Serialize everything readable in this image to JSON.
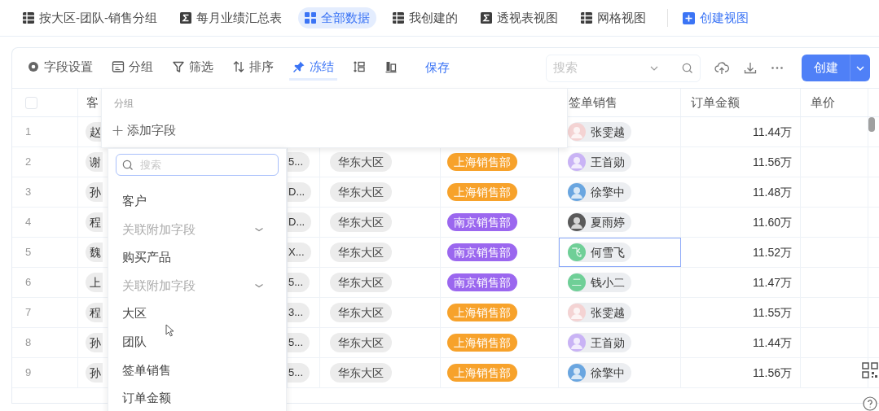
{
  "tabs": [
    {
      "label": "按大区-团队-销售分组",
      "kind": "grid",
      "selected": false
    },
    {
      "label": "每月业绩汇总表",
      "kind": "sigma",
      "selected": false
    },
    {
      "label": "全部数据",
      "kind": "tiles",
      "selected": true
    },
    {
      "label": "我创建的",
      "kind": "grid",
      "selected": false
    },
    {
      "label": "透视表视图",
      "kind": "sigma",
      "selected": false
    },
    {
      "label": "网格视图",
      "kind": "grid",
      "selected": false
    }
  ],
  "create_view": "创建视图",
  "toolbar": [
    {
      "kind": "gear",
      "label": "字段设置",
      "selected": false
    },
    {
      "kind": "group",
      "label": "分组",
      "selected": false
    },
    {
      "kind": "filter",
      "label": "筛选",
      "selected": false
    },
    {
      "kind": "sort",
      "label": "排序",
      "selected": false
    },
    {
      "kind": "pin",
      "label": "冻结",
      "selected": true
    },
    {
      "kind": "row-height",
      "selected": false
    },
    {
      "kind": "columns",
      "selected": false
    }
  ],
  "save": "保存",
  "search": {
    "placeholder": "搜索"
  },
  "create_button": "创建",
  "table": {
    "select_all": {
      "checked": false
    },
    "header": {
      "customer": "客",
      "seller": "签单销售",
      "amount": "订单金额",
      "price": "单价"
    },
    "rows": [
      {
        "number": "1",
        "customer": "赵",
        "seller": {
          "name": "张雯越",
          "color": "#f4d3d3",
          "selected": false
        },
        "amount": "11.44万"
      },
      {
        "number": "2",
        "customer": "谢",
        "code": "5...",
        "region": "华东大区",
        "team": {
          "label": "上海销售部",
          "color": "#f7a22b"
        },
        "seller": {
          "name": "王首勋",
          "color": "#c9b3f5",
          "selected": false
        },
        "amount": "11.56万"
      },
      {
        "number": "3",
        "customer": "孙",
        "code": "D...",
        "region": "华东大区",
        "team": {
          "label": "上海销售部",
          "color": "#f7a22b"
        },
        "seller": {
          "name": "徐擎中",
          "color": "#6aa6e0",
          "selected": false
        },
        "amount": "11.48万"
      },
      {
        "number": "4",
        "customer": "程",
        "code": "D...",
        "region": "华东大区",
        "team": {
          "label": "南京销售部",
          "color": "#9b67ef"
        },
        "seller": {
          "name": "夏雨婷",
          "color": "#5a5a5a",
          "selected": false
        },
        "amount": "11.60万"
      },
      {
        "number": "5",
        "customer": "魏",
        "code": "X...",
        "region": "华东大区",
        "team": {
          "label": "南京销售部",
          "color": "#9b67ef"
        },
        "seller": {
          "name": "何雪飞",
          "color": "#6fcf97",
          "initial": "飞",
          "selected": true
        },
        "amount": "11.52万"
      },
      {
        "number": "6",
        "customer": "上",
        "code": "5...",
        "region": "华东大区",
        "team": {
          "label": "南京销售部",
          "color": "#9b67ef"
        },
        "seller": {
          "name": "钱小二",
          "color": "#6fcf97",
          "initial": "二",
          "selected": false
        },
        "amount": "11.47万"
      },
      {
        "number": "7",
        "customer": "程",
        "code": "3...",
        "region": "华东大区",
        "team": {
          "label": "上海销售部",
          "color": "#f7a22b"
        },
        "seller": {
          "name": "张雯越",
          "color": "#f4d3d3",
          "selected": false
        },
        "amount": "11.55万"
      },
      {
        "number": "8",
        "customer": "孙",
        "code": "5...",
        "region": "华东大区",
        "team": {
          "label": "上海销售部",
          "color": "#f7a22b"
        },
        "seller": {
          "name": "王首勋",
          "color": "#c9b3f5",
          "selected": false
        },
        "amount": "11.44万"
      },
      {
        "number": "9",
        "customer": "孙",
        "code": "5...",
        "region": "华东大区",
        "team": {
          "label": "上海销售部",
          "color": "#f7a22b"
        },
        "seller": {
          "name": "徐擎中",
          "color": "#6aa6e0",
          "selected": false
        },
        "amount": "11.56万"
      }
    ]
  },
  "group_popup": {
    "title": "分组",
    "add_field": "添加字段",
    "search_placeholder": "搜索",
    "fields": [
      {
        "label": "客户",
        "kind": "field"
      },
      {
        "label": "关联附加字段",
        "kind": "linked"
      },
      {
        "label": "购买产品",
        "kind": "field"
      },
      {
        "label": "关联附加字段",
        "kind": "linked"
      },
      {
        "label": "大区",
        "kind": "field"
      },
      {
        "label": "团队",
        "kind": "field"
      },
      {
        "label": "签单销售",
        "kind": "field"
      },
      {
        "label": "订单金额",
        "kind": "field"
      }
    ]
  }
}
